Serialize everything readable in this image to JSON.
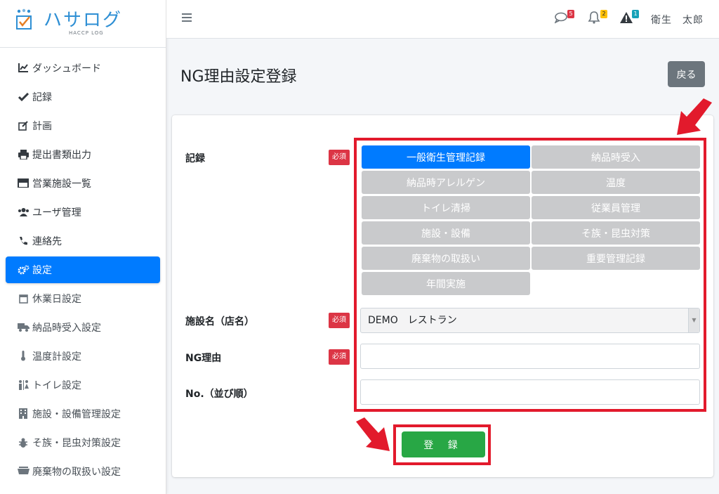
{
  "brand": {
    "name": "ハサログ",
    "sub": "HACCP LOG"
  },
  "sidebar": {
    "items": [
      {
        "label": "ダッシュボード",
        "icon": "chart-line-icon"
      },
      {
        "label": "記録",
        "icon": "check-icon"
      },
      {
        "label": "計画",
        "icon": "edit-icon"
      },
      {
        "label": "提出書類出力",
        "icon": "print-icon"
      },
      {
        "label": "営業施設一覧",
        "icon": "store-icon"
      },
      {
        "label": "ユーザ管理",
        "icon": "users-icon"
      },
      {
        "label": "連絡先",
        "icon": "phone-icon"
      },
      {
        "label": "設定",
        "icon": "cogs-icon"
      }
    ],
    "subitems": [
      {
        "label": "休業日設定",
        "icon": "calendar-icon"
      },
      {
        "label": "納品時受入設定",
        "icon": "truck-icon"
      },
      {
        "label": "温度計設定",
        "icon": "thermometer-icon"
      },
      {
        "label": "トイレ設定",
        "icon": "restroom-icon"
      },
      {
        "label": "施設・設備管理設定",
        "icon": "building-icon"
      },
      {
        "label": "そ族・昆虫対策設定",
        "icon": "bug-icon"
      },
      {
        "label": "廃棄物の取扱い設定",
        "icon": "dumpster-icon"
      }
    ]
  },
  "header": {
    "messages_count": "5",
    "notifications_count": "2",
    "alerts_count": "1",
    "user_name": "衛生　太郎",
    "colors": {
      "messages": "#dc3545",
      "notifications": "#ffc107",
      "alerts": "#17a2b8"
    }
  },
  "page": {
    "title": "NG理由設定登録",
    "back_label": "戻る"
  },
  "form": {
    "record_label": "記録",
    "required_label": "必須",
    "categories": [
      "一般衛生管理記録",
      "納品時受入",
      "納品時アレルゲン",
      "温度",
      "トイレ清掃",
      "従業員管理",
      "施設・設備",
      "そ族・昆虫対策",
      "廃棄物の取扱い",
      "重要管理記録",
      "年間実施"
    ],
    "selected_category": "一般衛生管理記録",
    "facility_label": "施設名（店名）",
    "facility_value": "DEMO　レストラン",
    "ng_reason_label": "NG理由",
    "ng_reason_value": "",
    "order_label": "No.（並び順）",
    "order_value": "",
    "submit_label": "登 録"
  },
  "colors": {
    "primary": "#007bff",
    "success": "#28a745",
    "danger": "#dc3545",
    "highlight": "#e21a2c",
    "secondary": "#6c757d"
  }
}
